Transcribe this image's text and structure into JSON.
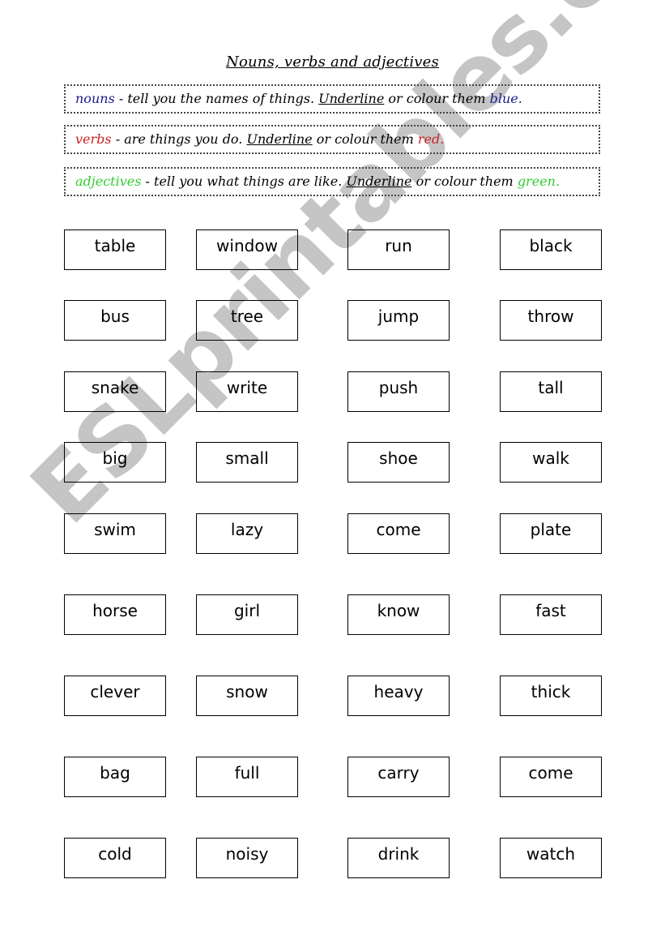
{
  "title": "Nouns, verbs and adjectives",
  "definitions": [
    {
      "term": "nouns",
      "term_color": "#1a1a8c",
      "text": " - tell you the names of things. ",
      "underline": "Underline",
      "rest": " or colour them ",
      "color_word": "blue",
      "end": "."
    },
    {
      "term": "verbs",
      "term_color": "#cc2020",
      "text": " - are things you do. ",
      "underline": "Underline",
      "rest": " or colour them ",
      "color_word": "red",
      "end": "."
    },
    {
      "term": "adjectives",
      "term_color": "#33cc33",
      "text": " - tell you what things are like. ",
      "underline": "Underline",
      "rest": " or colour them ",
      "color_word": "green",
      "end": "."
    }
  ],
  "words": [
    [
      "table",
      "window",
      "run",
      "black"
    ],
    [
      "bus",
      "tree",
      "jump",
      "throw"
    ],
    [
      "snake",
      "write",
      "push",
      "tall"
    ],
    [
      "big",
      "small",
      "shoe",
      "walk"
    ],
    [
      "swim",
      "lazy",
      "come",
      "plate"
    ],
    [
      "horse",
      "girl",
      "know",
      "fast"
    ],
    [
      "clever",
      "snow",
      "heavy",
      "thick"
    ],
    [
      "bag",
      "full",
      "carry",
      "come"
    ],
    [
      "cold",
      "noisy",
      "drink",
      "watch"
    ]
  ],
  "watermark": "ESLprintables.com"
}
